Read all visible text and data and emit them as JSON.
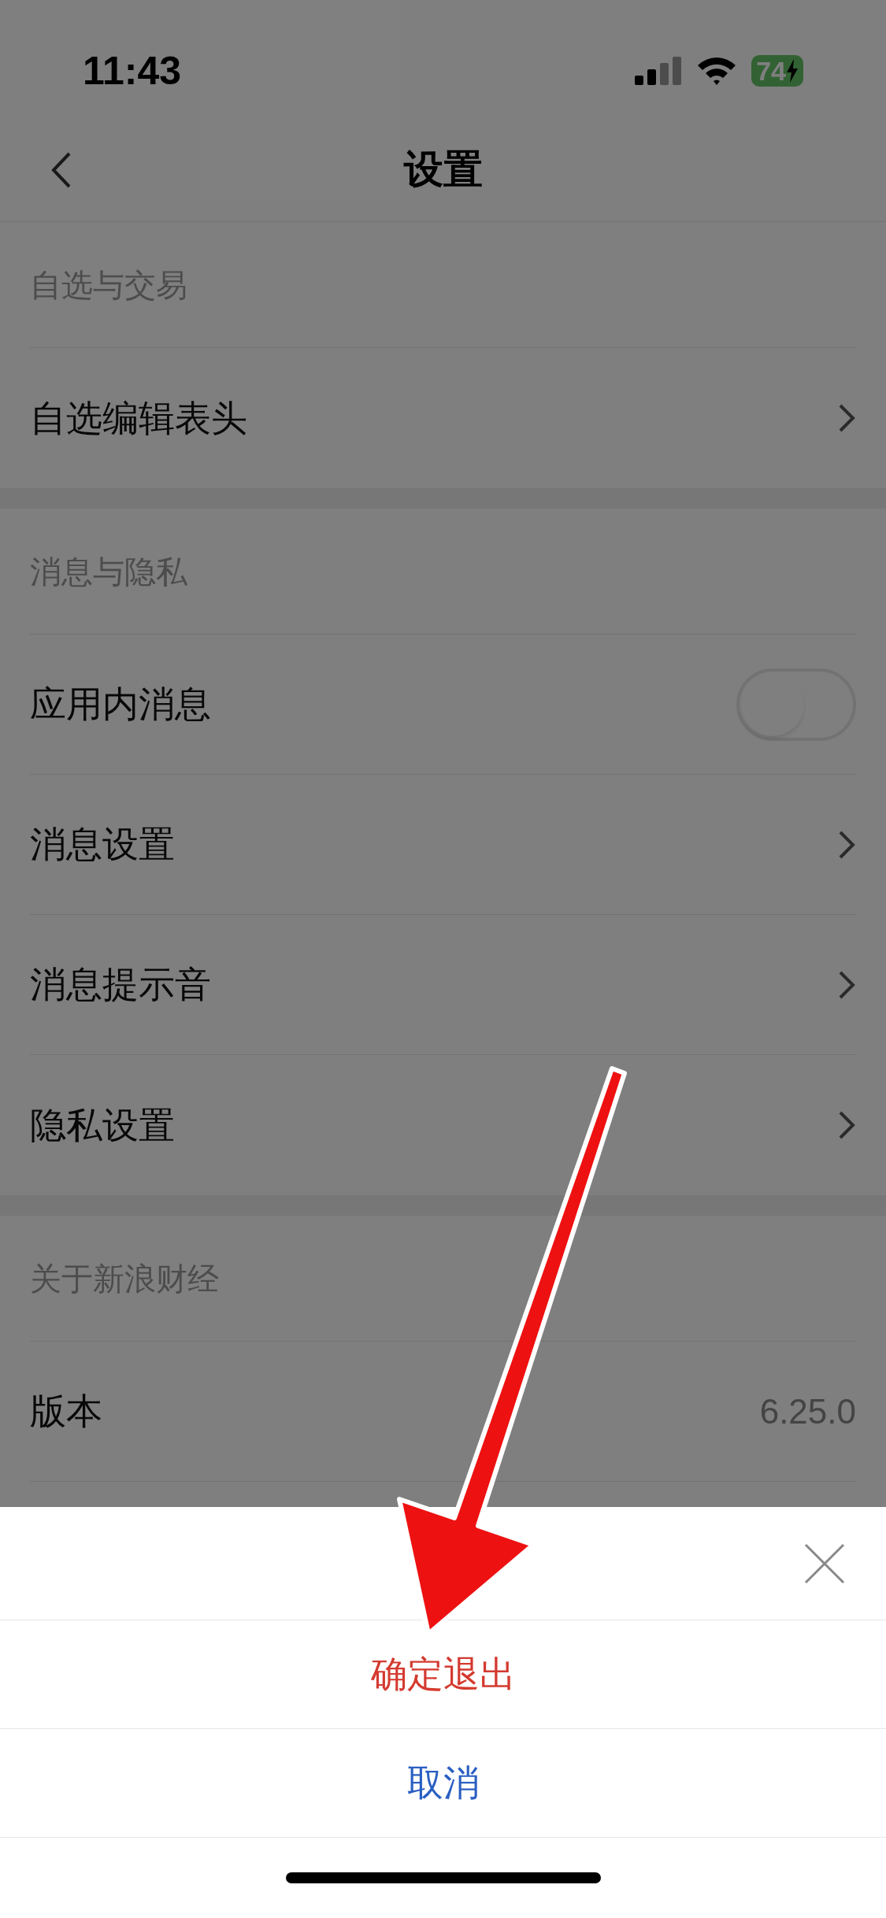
{
  "status_bar": {
    "time": "11:43",
    "battery": "74"
  },
  "nav": {
    "title": "设置"
  },
  "sections": [
    {
      "header": "自选与交易",
      "rows": [
        {
          "kind": "link",
          "label": "自选编辑表头"
        }
      ]
    },
    {
      "header": "消息与隐私",
      "rows": [
        {
          "kind": "toggle",
          "label": "应用内消息",
          "on": false
        },
        {
          "kind": "link",
          "label": "消息设置"
        },
        {
          "kind": "link",
          "label": "消息提示音"
        },
        {
          "kind": "link",
          "label": "隐私设置"
        }
      ]
    },
    {
      "header": "关于新浪财经",
      "rows": [
        {
          "kind": "value",
          "label": "版本",
          "value": "6.25.0"
        }
      ]
    }
  ],
  "sheet": {
    "confirm": "确定退出",
    "cancel": "取消"
  }
}
